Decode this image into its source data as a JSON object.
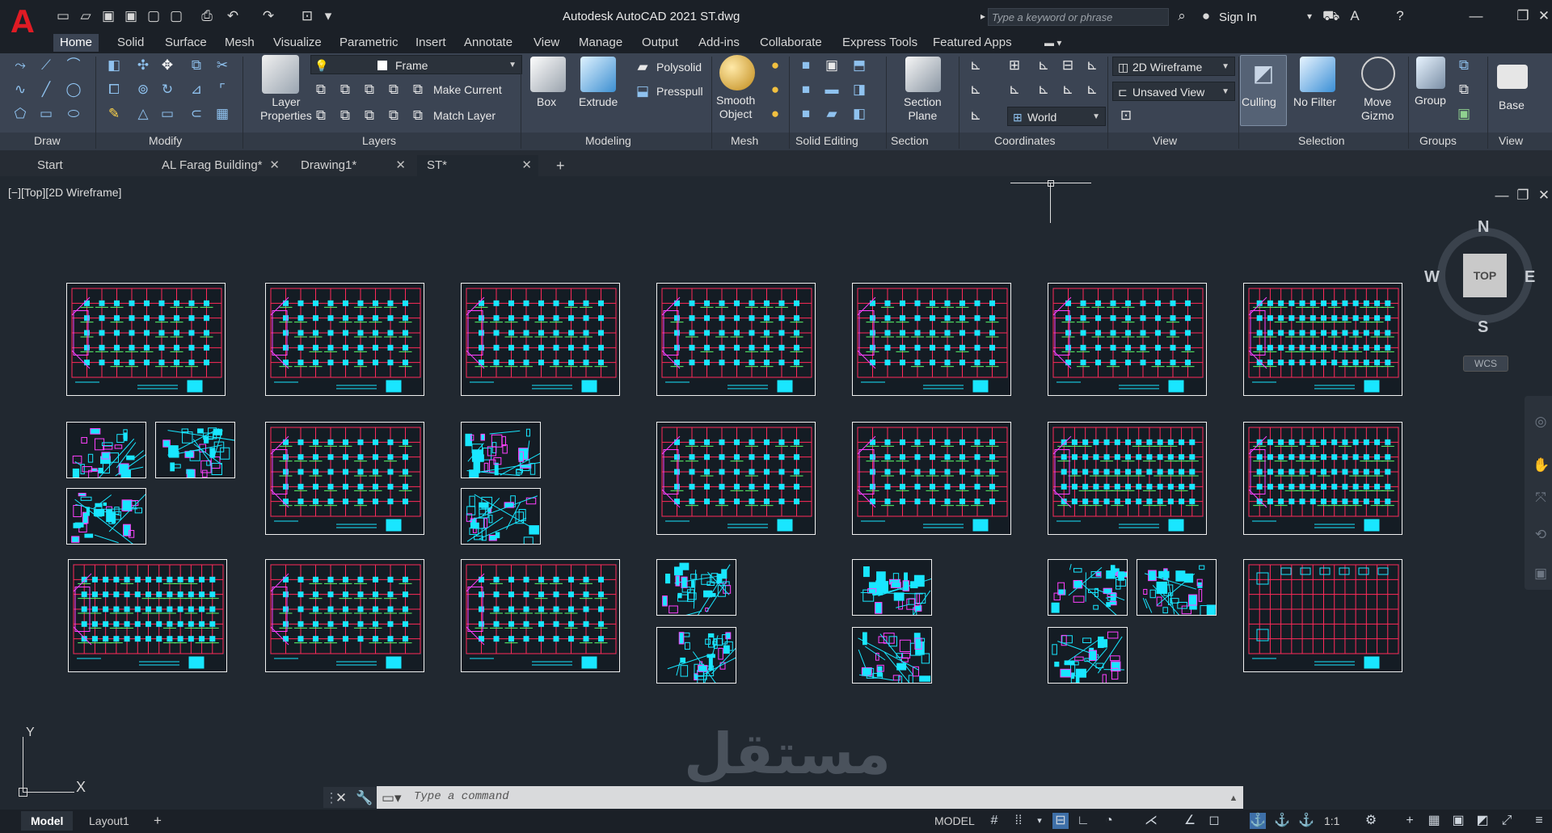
{
  "app": {
    "title": "Autodesk AutoCAD 2021   ST.dwg",
    "search_placeholder": "Type a keyword or phrase",
    "sign_in": "Sign In"
  },
  "ribbon_tabs": [
    "Home",
    "Solid",
    "Surface",
    "Mesh",
    "Visualize",
    "Parametric",
    "Insert",
    "Annotate",
    "View",
    "Manage",
    "Output",
    "Add-ins",
    "Collaborate",
    "Express Tools",
    "Featured Apps"
  ],
  "ribbon": {
    "layer_properties": "Layer\nProperties",
    "layer_current": "Frame",
    "make_current": "Make Current",
    "match_layer": "Match Layer",
    "box": "Box",
    "extrude": "Extrude",
    "polysolid": "Polysolid",
    "presspull": "Presspull",
    "smooth_object": "Smooth\nObject",
    "section_plane": "Section\nPlane",
    "visual_style": "2D Wireframe",
    "view_name": "Unsaved View",
    "ucs_name": "World",
    "culling": "Culling",
    "no_filter": "No Filter",
    "move_gizmo": "Move\nGizmo",
    "group": "Group",
    "base": "Base"
  },
  "panels": [
    "Draw",
    "Modify",
    "Layers",
    "Modeling",
    "Mesh",
    "Solid Editing",
    "Section",
    "Coordinates",
    "View",
    "Selection",
    "Groups",
    "View"
  ],
  "doc_tabs": [
    {
      "label": "Start",
      "closable": false
    },
    {
      "label": "AL Farag Building*",
      "closable": true
    },
    {
      "label": "Drawing1*",
      "closable": true
    },
    {
      "label": "ST*",
      "closable": true
    }
  ],
  "viewport": {
    "label": "[−][Top][2D Wireframe]",
    "viewcube": {
      "face": "TOP",
      "north": "N",
      "south": "S",
      "east": "E",
      "west": "W",
      "wcs": "WCS"
    },
    "ucs_x": "X",
    "ucs_y": "Y"
  },
  "command_line": {
    "placeholder": "Type a command"
  },
  "watermark": "مستقل",
  "status": {
    "layout_tabs": [
      {
        "label": "Model",
        "active": true
      },
      {
        "label": "Layout1",
        "active": false
      }
    ],
    "mode": "MODEL",
    "scale": "1:1"
  },
  "colors": {
    "accent": "#e01b24",
    "plan_cyan": "#19e6ff",
    "plan_red": "#ff2a5a",
    "plan_green": "#5bff6a",
    "plan_magenta": "#ff40ff"
  }
}
